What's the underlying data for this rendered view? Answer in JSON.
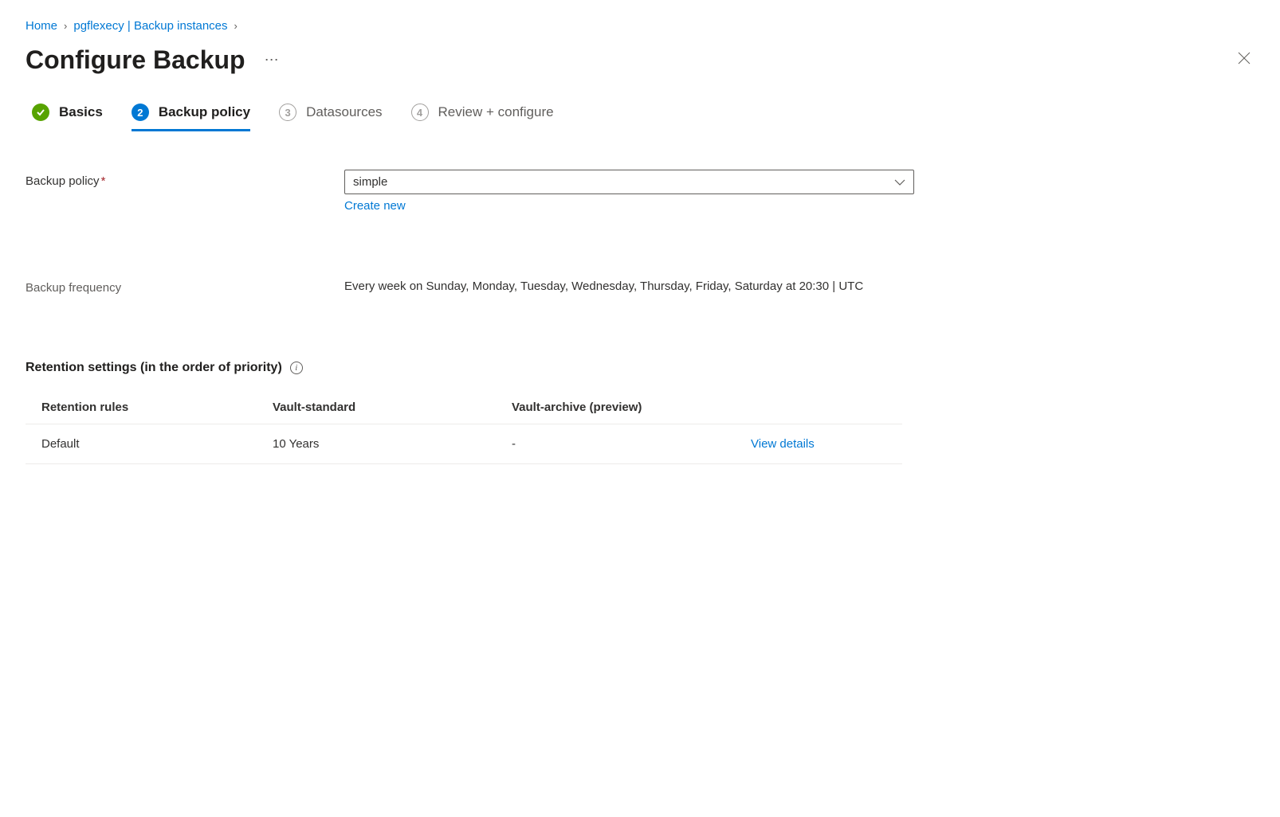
{
  "breadcrumb": {
    "home": "Home",
    "item2": "pgflexecy | Backup instances"
  },
  "page": {
    "title": "Configure Backup"
  },
  "tabs": {
    "basics": "Basics",
    "backup_policy": "Backup policy",
    "datasources": "Datasources",
    "review": "Review + configure",
    "num3": "3",
    "num4": "4"
  },
  "form": {
    "backup_policy_label": "Backup policy",
    "backup_policy_value": "simple",
    "create_new": "Create new",
    "backup_frequency_label": "Backup frequency",
    "backup_frequency_value": "Every week on Sunday, Monday, Tuesday, Wednesday, Thursday, Friday, Saturday at 20:30 | UTC"
  },
  "retention": {
    "section_title": "Retention settings (in the order of priority)",
    "col_rules": "Retention rules",
    "col_standard": "Vault-standard",
    "col_archive": "Vault-archive (preview)",
    "rows": [
      {
        "rule": "Default",
        "standard": "10 Years",
        "archive": "-",
        "action": "View details"
      }
    ]
  }
}
